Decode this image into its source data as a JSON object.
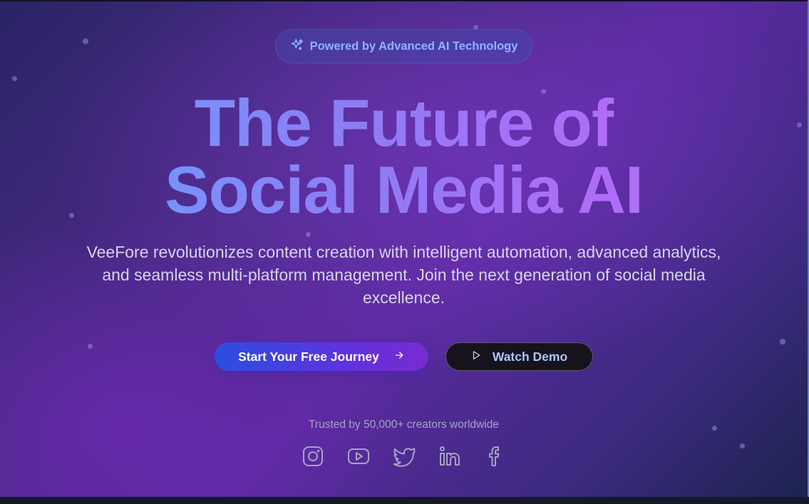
{
  "badge": {
    "icon": "sparkles-icon",
    "text": "Powered by Advanced AI Technology"
  },
  "hero": {
    "title_line1": "The Future of",
    "title_line2": "Social Media AI",
    "subtitle": "VeeFore revolutionizes content creation with intelligent automation, advanced analytics, and seamless multi-platform management. Join the next generation of social media excellence."
  },
  "cta": {
    "primary_label": "Start Your Free Journey",
    "primary_icon": "arrow-right-icon",
    "secondary_label": "Watch Demo",
    "secondary_icon": "play-icon"
  },
  "trust": {
    "text": "Trusted by 50,000+ creators worldwide"
  },
  "socials": [
    {
      "name": "instagram-icon"
    },
    {
      "name": "youtube-icon"
    },
    {
      "name": "twitter-icon"
    },
    {
      "name": "linkedin-icon"
    },
    {
      "name": "facebook-icon"
    }
  ],
  "colors": {
    "accent_blue": "#66a3ff",
    "accent_purple": "#b06cf7",
    "badge_text": "#8fb4ff",
    "primary_button": "#4a3fe0",
    "secondary_button": "#17131c",
    "icon_color": "#a6a3c4"
  }
}
